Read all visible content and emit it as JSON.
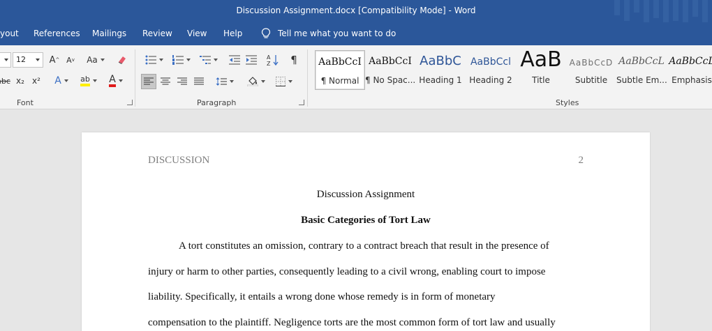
{
  "window": {
    "title": "Discussion Assignment.docx [Compatibility Mode]  -  Word"
  },
  "menu": {
    "items": [
      "yout",
      "References",
      "Mailings",
      "Review",
      "View",
      "Help"
    ],
    "tell_me": "Tell me what you want to do"
  },
  "ribbon": {
    "font": {
      "size": "12",
      "group_label": "Font",
      "grow_glyph": "A",
      "shrink_glyph": "A",
      "case_glyph": "Aa",
      "strike_glyph": "abc",
      "subscript_glyph": "x₂",
      "superscript_glyph": "x²",
      "font_color_glyph": "A",
      "text_effects_glyph": "A",
      "highlight_glyph": "ab"
    },
    "paragraph": {
      "group_label": "Paragraph",
      "pilcrow": "¶"
    },
    "styles": {
      "group_label": "Styles",
      "items": [
        {
          "sample": "AaBbCcI",
          "name": "¶ Normal"
        },
        {
          "sample": "AaBbCcI",
          "name": "¶ No Spac..."
        },
        {
          "sample": "AaBbC",
          "name": "Heading 1"
        },
        {
          "sample": "AaBbCcl",
          "name": "Heading 2"
        },
        {
          "sample": "AaB",
          "name": "Title"
        },
        {
          "sample": "AaBbCcD",
          "name": "Subtitle"
        },
        {
          "sample": "AaBbCcL",
          "name": "Subtle Em..."
        },
        {
          "sample": "AaBbCcL",
          "name": "Emphasis"
        }
      ]
    }
  },
  "document": {
    "header_left": "DISCUSSION",
    "header_right": "2",
    "title": "Discussion Assignment",
    "heading": "Basic Categories of Tort Law",
    "lines": [
      "A tort constitutes an omission, contrary to a contract breach that result in the presence of",
      "injury or harm to other parties, consequently leading to a civil wrong, enabling court to impose",
      "liability. Specifically, it entails a wrong done whose remedy is in form of monetary",
      "compensation to the plaintiff. Negligence torts are the most common form of tort law and usually"
    ]
  },
  "colors": {
    "accent": "#2b579a",
    "ribbon_bg": "#f3f3f3",
    "canvas_bg": "#e6e6e6"
  }
}
